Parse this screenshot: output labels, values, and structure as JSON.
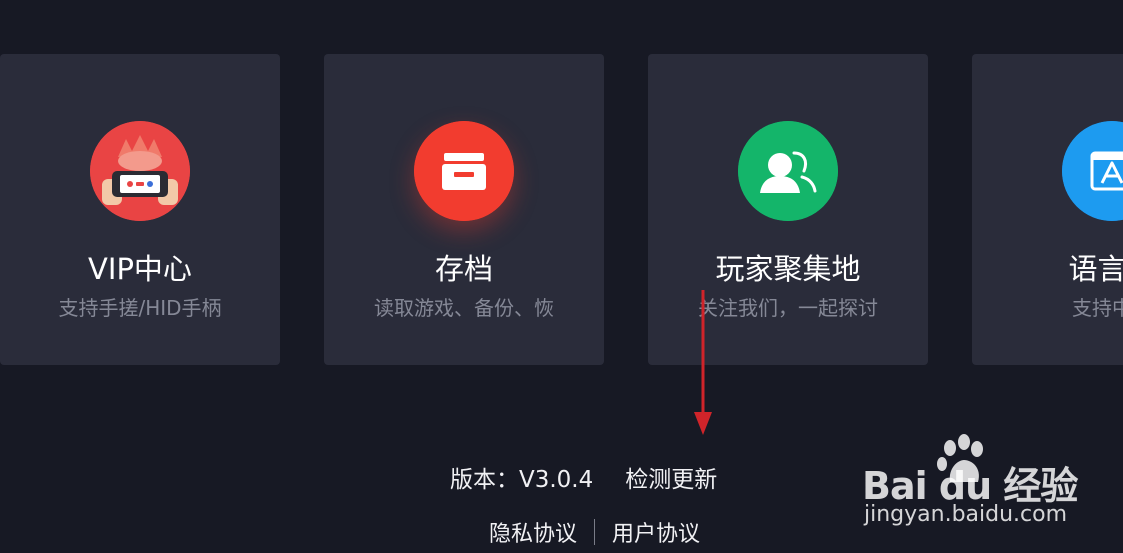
{
  "cards": [
    {
      "title": "VIP中心",
      "subtitle": "支持手搓/HID手柄",
      "icon": "vip-gamepad-icon",
      "icon_color": "#e94444"
    },
    {
      "title": "存档",
      "subtitle": "读取游戏、备份、恢",
      "icon": "archive-box-icon",
      "icon_color": "#f23c2f"
    },
    {
      "title": "玩家聚集地",
      "subtitle": "关注我们，一起探讨",
      "icon": "users-icon",
      "icon_color": "#14b56a"
    },
    {
      "title": "语言切",
      "subtitle": "支持中、",
      "icon": "language-icon",
      "icon_color": "#1d9bf0"
    }
  ],
  "footer": {
    "version_label": "版本：V3.0.4",
    "check_update": "检测更新",
    "privacy": "隐私协议",
    "user_agreement": "用户协议"
  },
  "watermark": {
    "brand": "Bai du 经验",
    "url": "jingyan.baidu.com"
  },
  "colors": {
    "background": "#171924",
    "card": "#2a2c3a",
    "annotation_arrow": "#d0242a"
  }
}
